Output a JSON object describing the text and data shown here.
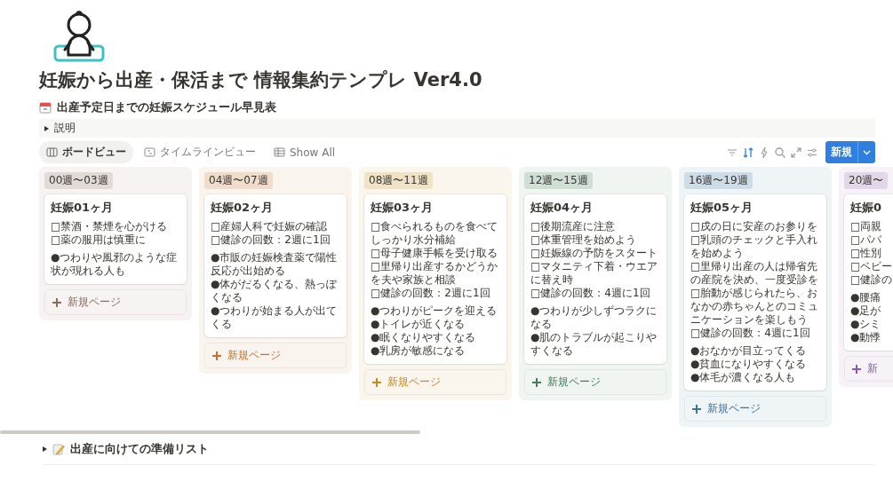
{
  "page": {
    "title": "妊娠から出産・保活まで 情報集約テンプレ Ver4.0"
  },
  "database": {
    "title": "出産予定日までの妊娠スケジュール早見表",
    "toggle": {
      "label": "説明",
      "expanded": false
    },
    "views": [
      {
        "label": "ボードビュー",
        "kind": "board",
        "selected": true
      },
      {
        "label": "タイムラインビュー",
        "kind": "timeline",
        "selected": false
      },
      {
        "label": "Show All",
        "kind": "table",
        "selected": false
      }
    ],
    "toolbar": {
      "sort_active": true,
      "new_button": "新規"
    },
    "columns": [
      {
        "label": "00週〜03週",
        "color": "#8c6a5d",
        "add_label": "新規ページ",
        "cards": [
          {
            "title": "妊娠01ヶ月",
            "todos": [
              "□禁酒・禁煙を心がける",
              "□薬の服用は慎重に"
            ],
            "notes": [
              "●つわりや風邪のような症状が現れる人も"
            ]
          }
        ]
      },
      {
        "label": "04週〜07週",
        "color": "#c4712e",
        "add_label": "新規ページ",
        "cards": [
          {
            "title": "妊娠02ヶ月",
            "todos": [
              "□産婦人科で妊娠の確認",
              "□健診の回数：2週に1回"
            ],
            "notes": [
              "●市販の妊娠検査薬で陽性反応が出始める",
              "●体がだるくなる、熱っぽくなる",
              "●つわりが始まる人が出てくる"
            ]
          }
        ]
      },
      {
        "label": "08週〜11週",
        "color": "#c48a1c",
        "add_label": "新規ページ",
        "cards": [
          {
            "title": "妊娠03ヶ月",
            "todos": [
              "□食べられるものを食べてしっかり水分補給",
              "□母子健康手帳を受け取る",
              "□里帰り出産するかどうかを夫や家族と相談",
              "□健診の回数：2週に1回"
            ],
            "notes": [
              "●つわりがピークを迎える",
              "●トイレが近くなる",
              "●眠くなりやすくなる",
              "●乳房が敏感になる"
            ]
          }
        ]
      },
      {
        "label": "12週〜15週",
        "color": "#3e7d58",
        "add_label": "新規ページ",
        "cards": [
          {
            "title": "妊娠04ヶ月",
            "todos": [
              "□後期流産に注意",
              "□体重管理を始めよう",
              "□妊娠線の予防をスタート",
              "□マタニティ下着・ウエアに替え時",
              "□健診の回数：4週に1回"
            ],
            "notes": [
              "●つわりが少しずつラクになる",
              "●肌のトラブルが起こりやすくなる"
            ]
          }
        ]
      },
      {
        "label": "16週〜19週",
        "color": "#3a72a0",
        "add_label": "新規ページ",
        "cards": [
          {
            "title": "妊娠05ヶ月",
            "todos": [
              "□戌の日に安産のお参りを",
              "□乳頭のチェックと手入れを始めよう",
              "□里帰り出産の人は帰省先の産院を決め、一度受診を",
              "□胎動が感じられたら、おなかの赤ちゃんとのコミュニケーションを楽しもう",
              "□健診の回数：4週に1回"
            ],
            "notes": [
              "●おなかが目立ってくる",
              "●貧血になりやすくなる",
              "●体毛が濃くなる人も"
            ]
          }
        ]
      },
      {
        "label": "20週〜",
        "color": "#8a5aa8",
        "add_label": "新",
        "cards": [
          {
            "title": "妊娠0",
            "todos": [
              "□両親",
              "□パパ",
              "□性別",
              "□ベビー",
              "□健診の"
            ],
            "notes": [
              "●腰痛",
              "●足が",
              "●シミ",
              "●動悸"
            ]
          }
        ]
      }
    ]
  },
  "sections": [
    {
      "label": "出産に向けての準備リスト",
      "expanded": false
    }
  ]
}
